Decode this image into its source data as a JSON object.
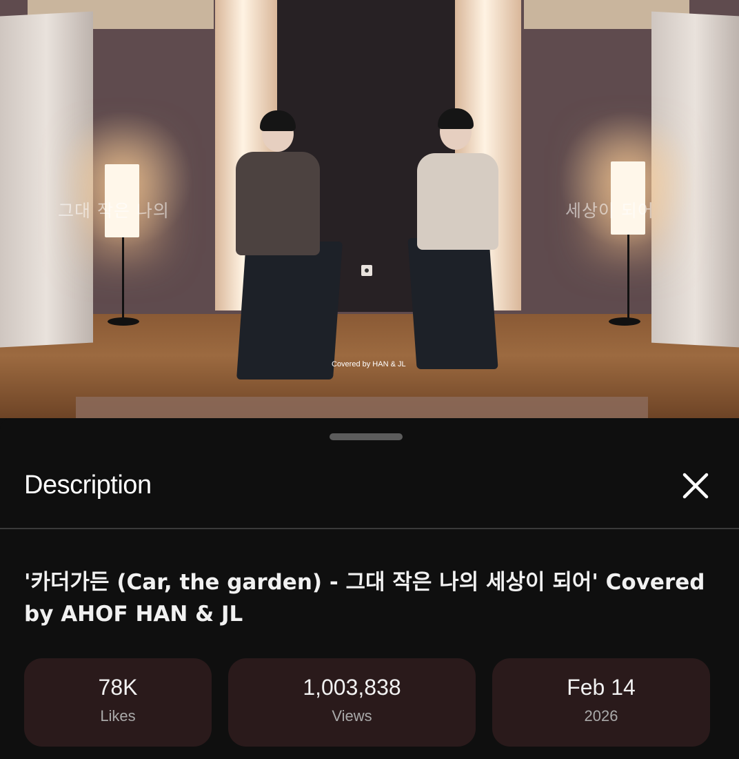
{
  "video": {
    "lyric_left": "그대 작은 나의",
    "lyric_right": "세상이 되어",
    "credit": "Covered by HAN & JL"
  },
  "description_panel": {
    "title": "Description",
    "video_title": "'카더가든 (Car, the garden) - 그대 작은 나의 세상이 되어' Covered by AHOF HAN & JL",
    "stats": [
      {
        "value": "78K",
        "label": "Likes"
      },
      {
        "value": "1,003,838",
        "label": "Views"
      },
      {
        "value": "Feb 14",
        "label": "2026"
      }
    ]
  },
  "icons": {
    "close": "close-icon"
  }
}
